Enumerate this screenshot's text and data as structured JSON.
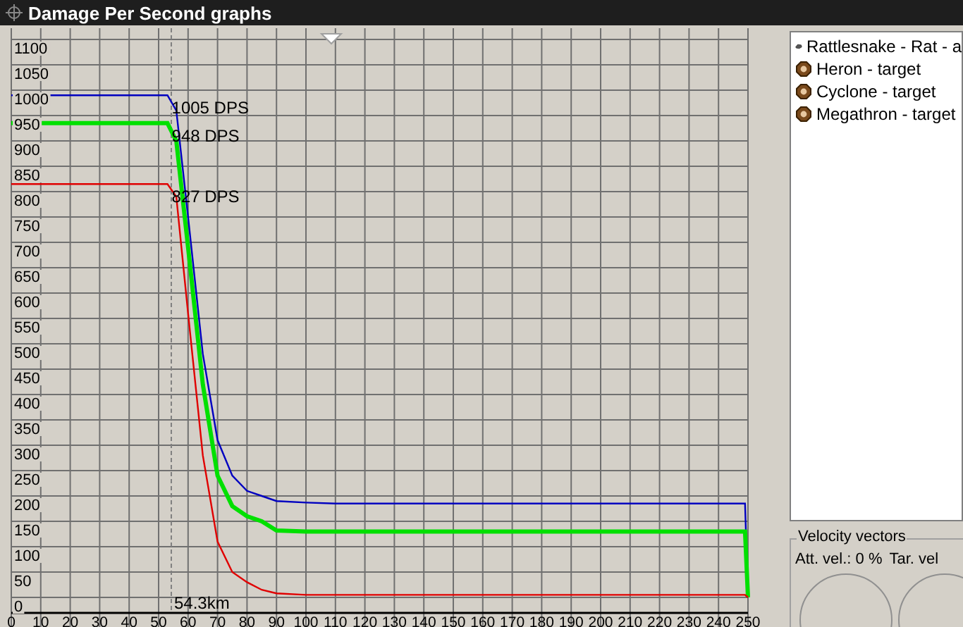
{
  "window": {
    "title": "Damage Per Second graphs"
  },
  "graph": {
    "chart_data": {
      "type": "line",
      "x": [
        0,
        53,
        56,
        60,
        65,
        70,
        75,
        80,
        85,
        90,
        100,
        110,
        249,
        250
      ],
      "series": [
        {
          "name": "1005 DPS",
          "color": "#0000c0",
          "values": [
            990,
            990,
            960,
            750,
            480,
            310,
            240,
            210,
            200,
            190,
            187,
            185,
            185,
            0
          ]
        },
        {
          "name": "948 DPS",
          "color": "#00e000",
          "values": [
            935,
            935,
            900,
            690,
            420,
            240,
            180,
            160,
            150,
            132,
            130,
            130,
            130,
            0
          ]
        },
        {
          "name": "827 DPS",
          "color": "#e00000",
          "values": [
            815,
            815,
            790,
            560,
            280,
            110,
            50,
            30,
            15,
            8,
            5,
            5,
            5,
            0
          ]
        }
      ],
      "xlim": [
        0,
        250
      ],
      "ylim": [
        0,
        1100
      ],
      "grid": true,
      "xticks": [
        0,
        10,
        20,
        30,
        40,
        50,
        60,
        70,
        80,
        90,
        100,
        110,
        120,
        130,
        140,
        150,
        160,
        170,
        180,
        190,
        200,
        210,
        220,
        230,
        240,
        250
      ],
      "yticks": [
        0,
        50,
        100,
        150,
        200,
        250,
        300,
        350,
        400,
        450,
        500,
        550,
        600,
        650,
        700,
        750,
        800,
        850,
        900,
        950,
        1000,
        1050,
        1100
      ],
      "ref_lines": [
        {
          "axis": "x",
          "value": 54.3,
          "label": "54.3km"
        }
      ]
    }
  },
  "targets": {
    "items": [
      {
        "label": "Rattlesnake - Rat - a",
        "kind": "attacker"
      },
      {
        "label": "Heron - target",
        "kind": "target"
      },
      {
        "label": "Cyclone - target",
        "kind": "target"
      },
      {
        "label": "Megathron - target",
        "kind": "target"
      }
    ]
  },
  "velocity_vectors": {
    "title": "Velocity vectors",
    "attacker_label": "Att. vel.: 0 %",
    "target_label": "Tar. vel"
  }
}
